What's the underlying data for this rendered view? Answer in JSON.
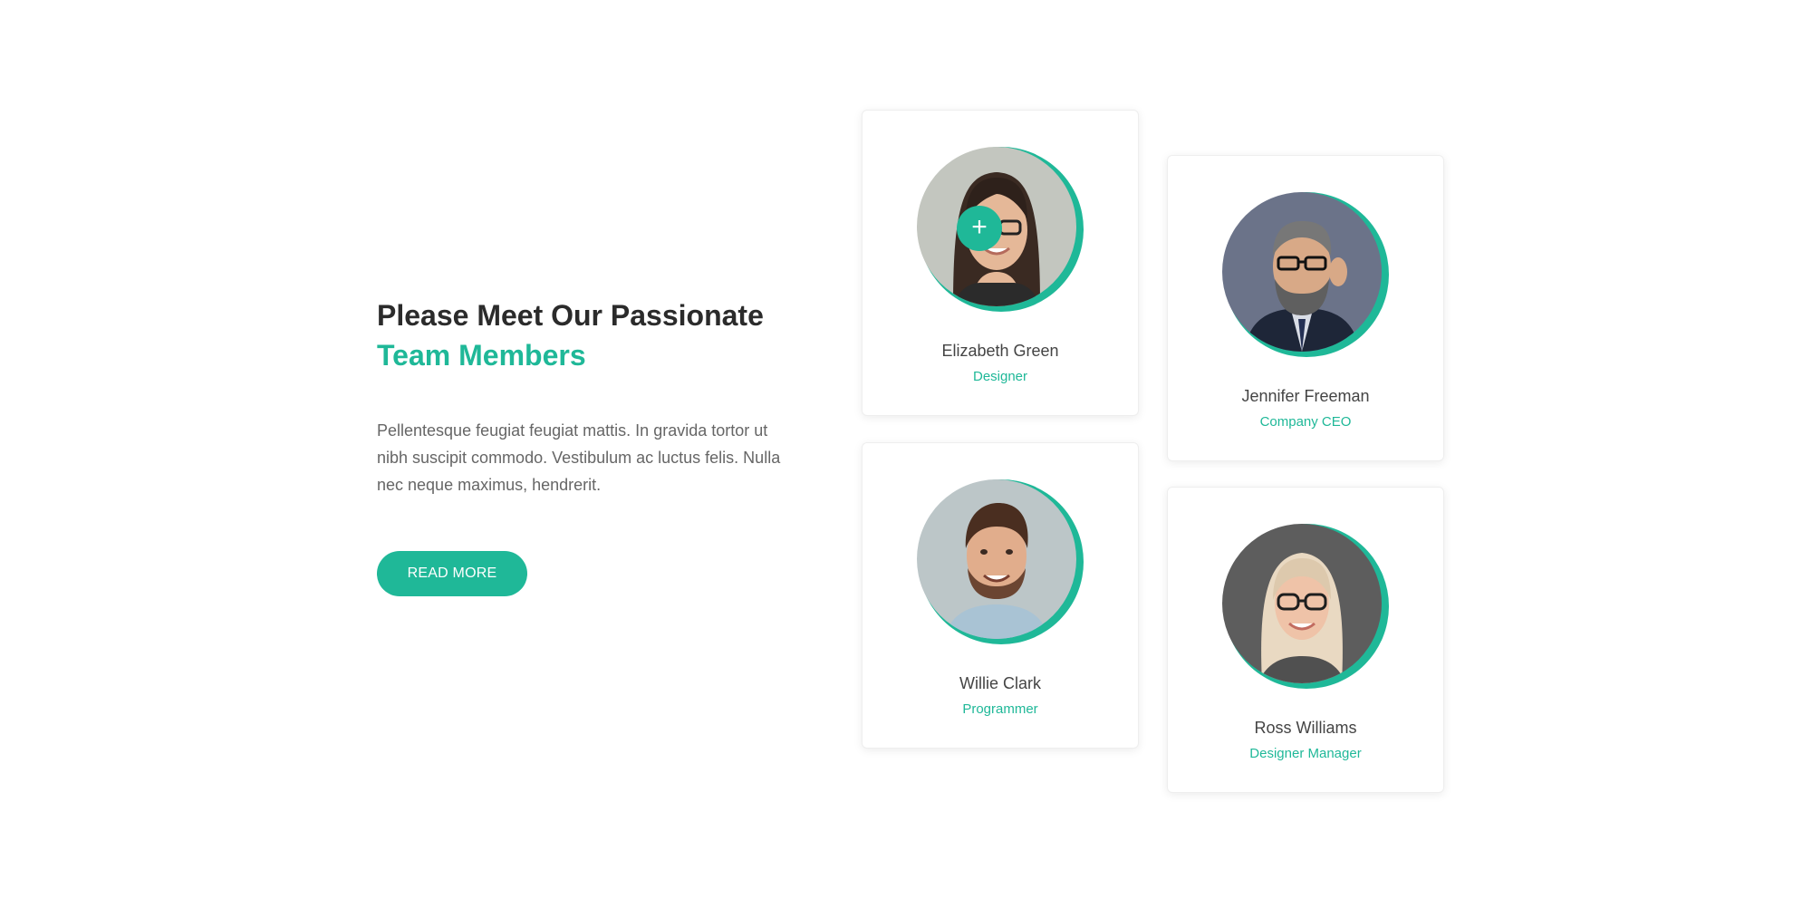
{
  "intro": {
    "heading_line1": "Please Meet Our Passionate",
    "heading_line2": "Team Members",
    "body": "Pellentesque feugiat feugiat mattis. In gravida tortor ut nibh suscipit commodo. Vestibulum ac luctus felis. Nulla nec neque maximus, hendrerit.",
    "button_label": "READ MORE"
  },
  "team": [
    {
      "name": "Elizabeth Green",
      "role": "Designer"
    },
    {
      "name": "Jennifer Freeman",
      "role": "Company CEO"
    },
    {
      "name": "Willie Clark",
      "role": "Programmer"
    },
    {
      "name": "Ross Williams",
      "role": "Designer Manager"
    }
  ],
  "icons": {
    "expand": "plus-icon"
  },
  "colors": {
    "accent": "#1fb898",
    "heading": "#2b2b2b",
    "body_text": "#666666"
  }
}
